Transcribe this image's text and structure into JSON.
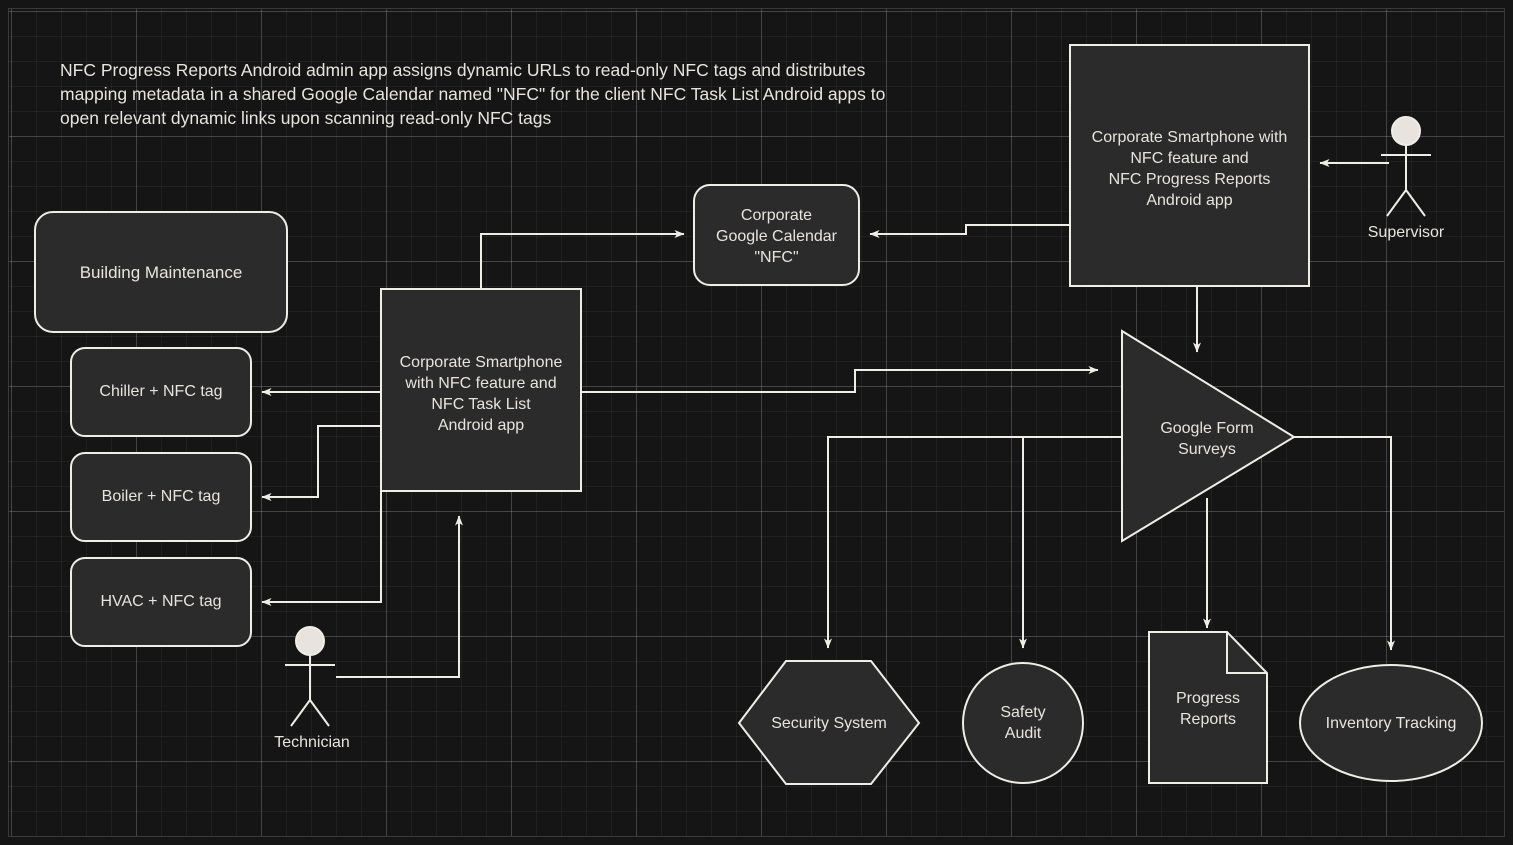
{
  "diagram": {
    "title": "NFC Progress Reports Android admin app assigns dynamic URLs to read-only NFC tags and distributes mapping metadata in a shared Google Calendar named \"NFC\" for the client NFC Task List Android apps to open relevant dynamic links upon scanning read-only NFC tags",
    "theme": {
      "background": "#151515",
      "grid_minor": "#2a2a2a",
      "grid_major": "#3d3d3d",
      "node_fill": "#2b2b2b",
      "node_stroke": "#f0ede6",
      "text": "#e8e4dd",
      "edge": "#f0ede6"
    },
    "nodes": [
      {
        "id": "building-maintenance",
        "label": "Building Maintenance",
        "shape": "rounded-rectangle",
        "font_size": 17
      },
      {
        "id": "chiller",
        "label": "Chiller + NFC tag",
        "shape": "rounded-rectangle",
        "font_size": 16
      },
      {
        "id": "boiler",
        "label": "Boiler + NFC tag",
        "shape": "rounded-rectangle",
        "font_size": 16
      },
      {
        "id": "hvac",
        "label": "HVAC + NFC tag",
        "shape": "rounded-rectangle",
        "font_size": 16
      },
      {
        "id": "task-list-phone",
        "label": "Corporate Smartphone\nwith NFC feature and\nNFC Task List\nAndroid app",
        "shape": "rectangle",
        "font_size": 16
      },
      {
        "id": "google-calendar",
        "label": "Corporate\nGoogle Calendar\n\"NFC\"",
        "shape": "rounded-rectangle",
        "font_size": 16
      },
      {
        "id": "admin-phone",
        "label": "Corporate Smartphone with\nNFC feature and\nNFC Progress Reports\nAndroid app",
        "shape": "rectangle",
        "font_size": 16
      },
      {
        "id": "google-form-surveys",
        "label": "Google Form\nSurveys",
        "shape": "triangle-right",
        "font_size": 16
      },
      {
        "id": "security-system",
        "label": "Security System",
        "shape": "hexagon",
        "font_size": 16
      },
      {
        "id": "safety-audit",
        "label": "Safety\nAudit",
        "shape": "circle",
        "font_size": 16
      },
      {
        "id": "progress-reports",
        "label": "Progress\nReports",
        "shape": "document-note",
        "font_size": 16
      },
      {
        "id": "inventory-tracking",
        "label": "Inventory Tracking",
        "shape": "ellipse",
        "font_size": 16
      }
    ],
    "actors": [
      {
        "id": "supervisor",
        "label": "Supervisor"
      },
      {
        "id": "technician",
        "label": "Technician"
      }
    ],
    "edges": [
      {
        "from": "task-list-phone",
        "to": "chiller"
      },
      {
        "from": "task-list-phone",
        "to": "boiler"
      },
      {
        "from": "task-list-phone",
        "to": "hvac"
      },
      {
        "from": "task-list-phone",
        "to": "google-calendar"
      },
      {
        "from": "task-list-phone",
        "to": "google-form-surveys"
      },
      {
        "from": "technician",
        "to": "task-list-phone"
      },
      {
        "from": "supervisor",
        "to": "admin-phone"
      },
      {
        "from": "admin-phone",
        "to": "google-calendar"
      },
      {
        "from": "admin-phone",
        "to": "google-form-surveys"
      },
      {
        "from": "google-form-surveys",
        "to": "security-system"
      },
      {
        "from": "google-form-surveys",
        "to": "safety-audit"
      },
      {
        "from": "google-form-surveys",
        "to": "progress-reports"
      },
      {
        "from": "google-form-surveys",
        "to": "inventory-tracking"
      }
    ]
  }
}
